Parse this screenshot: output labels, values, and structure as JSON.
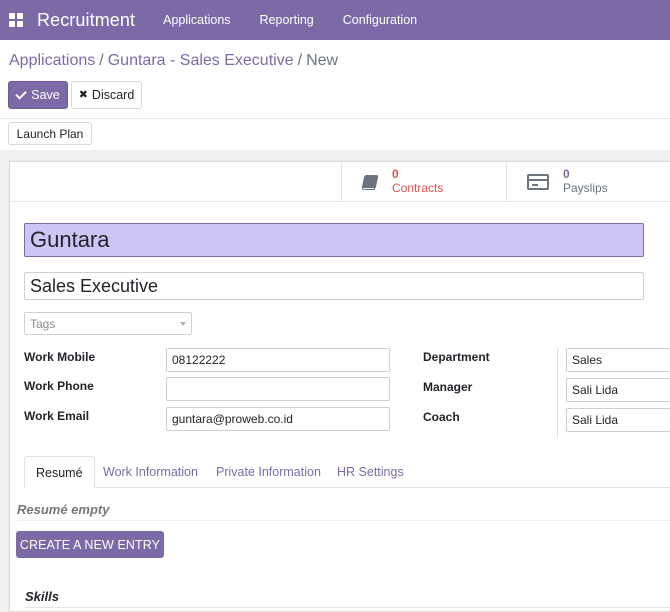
{
  "navbar": {
    "brand": "Recruitment",
    "menu": [
      "Applications",
      "Reporting",
      "Configuration"
    ]
  },
  "breadcrumb": {
    "items": [
      "Applications",
      "Guntara - Sales Executive"
    ],
    "current": "New"
  },
  "actions": {
    "save": "Save",
    "discard": "Discard",
    "launch_plan": "Launch Plan"
  },
  "stats": {
    "contracts": {
      "count": "0",
      "label": "Contracts",
      "icon": "book-icon"
    },
    "payslips": {
      "count": "0",
      "label": "Payslips",
      "icon": "credit-card-icon"
    }
  },
  "employee": {
    "name": "Guntara",
    "job_title": "Sales Executive",
    "tags_placeholder": "Tags"
  },
  "fields_left": [
    {
      "label": "Work Mobile",
      "value": "08122222"
    },
    {
      "label": "Work Phone",
      "value": ""
    },
    {
      "label": "Work Email",
      "value": "guntara@proweb.co.id"
    }
  ],
  "fields_right": [
    {
      "label": "Department",
      "value": "Sales"
    },
    {
      "label": "Manager",
      "value": "Sali Lida"
    },
    {
      "label": "Coach",
      "value": "Sali Lida"
    }
  ],
  "tabs": [
    "Resumé",
    "Work Information",
    "Private Information",
    "HR Settings"
  ],
  "resume": {
    "empty_text": "Resumé empty",
    "create_button": "CREATE A NEW ENTRY"
  },
  "skills": {
    "title": "Skills"
  },
  "colors": {
    "primary": "#7c6aa6",
    "name_field_bg": "#cdc6f5",
    "contracts": "#d9534f"
  }
}
